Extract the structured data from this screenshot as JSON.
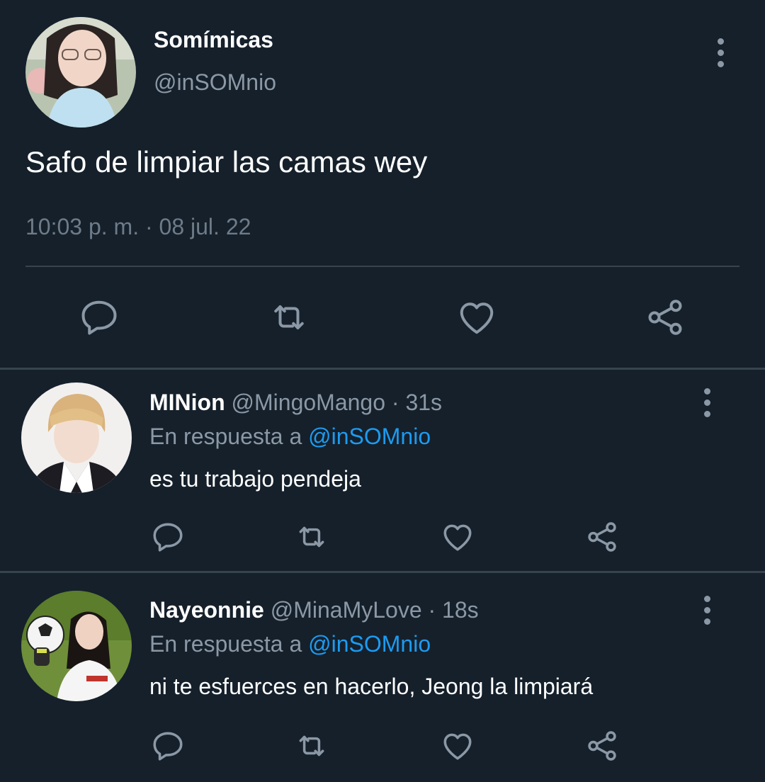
{
  "main_tweet": {
    "name": "Somímicas",
    "handle": "@inSOMnio",
    "text": "Safo de limpiar las camas wey",
    "timestamp": "10:03 p. m. · 08 jul. 22"
  },
  "replies": [
    {
      "name": "MINion",
      "handle_time": "@MingoMango · 31s",
      "reply_prefix": "En respuesta a",
      "reply_mention": "@inSOMnio",
      "text": "es tu trabajo pendeja"
    },
    {
      "name": "Nayeonnie",
      "handle_time": "@MinaMyLove · 18s",
      "reply_prefix": "En respuesta a",
      "reply_mention": "@inSOMnio",
      "text": "ni te esfuerces en hacerlo, Jeong la limpiará"
    }
  ],
  "icons": [
    "reply-icon",
    "retweet-icon",
    "like-icon",
    "share-icon",
    "more-icon"
  ],
  "colors": {
    "background": "#15202b",
    "text": "#ffffff",
    "secondary": "#8b98a5",
    "mention": "#1d9bf0",
    "divider": "#38444d"
  }
}
